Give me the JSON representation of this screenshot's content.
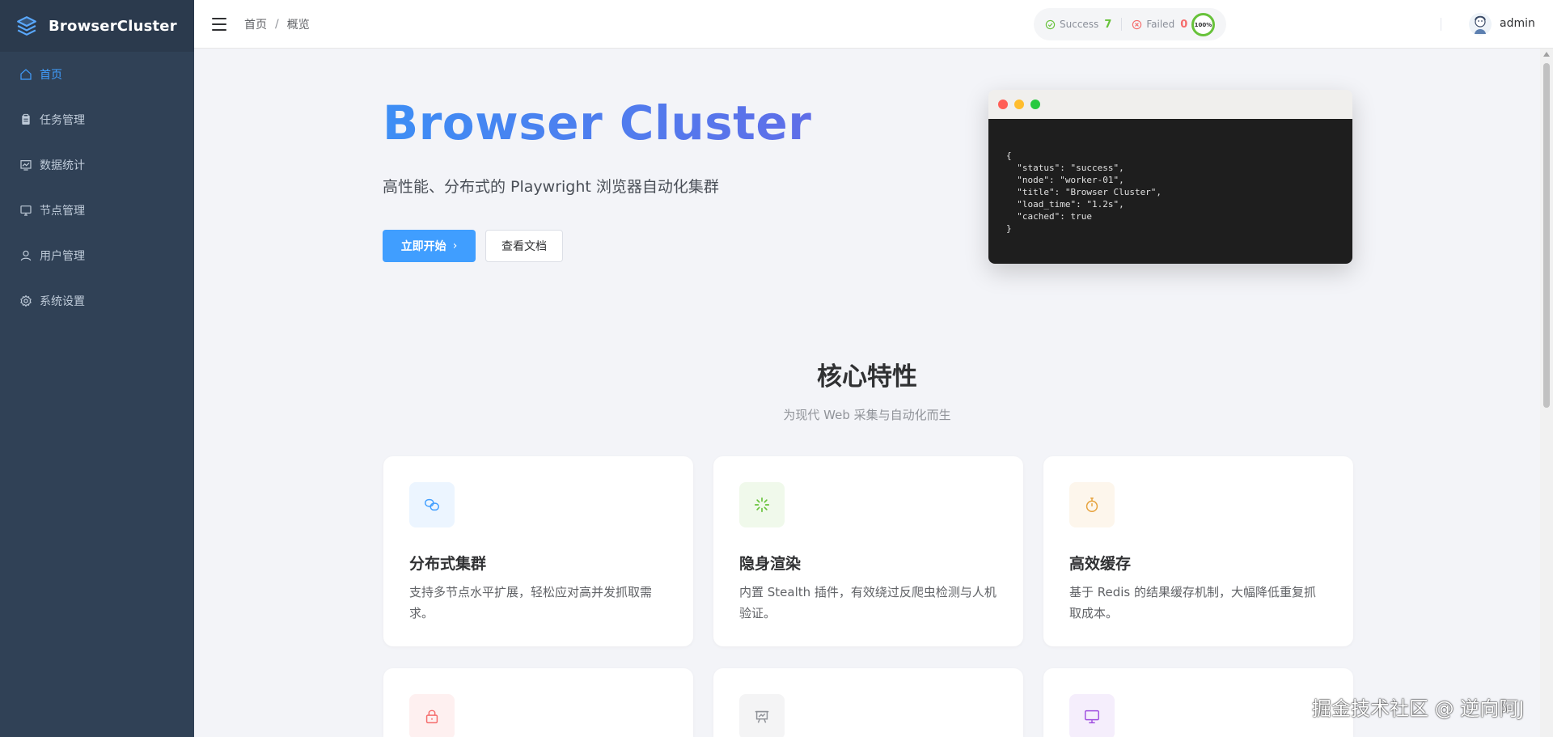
{
  "brand": {
    "name": "BrowserCluster",
    "icon": "layers-icon"
  },
  "sidebar": {
    "items": [
      {
        "label": "首页",
        "icon": "home-icon",
        "active": true
      },
      {
        "label": "任务管理",
        "icon": "clipboard-icon",
        "active": false
      },
      {
        "label": "数据统计",
        "icon": "chart-icon",
        "active": false
      },
      {
        "label": "节点管理",
        "icon": "monitor-icon",
        "active": false
      },
      {
        "label": "用户管理",
        "icon": "user-icon",
        "active": false
      },
      {
        "label": "系统设置",
        "icon": "gear-icon",
        "active": false
      }
    ]
  },
  "header": {
    "breadcrumb": [
      "首页",
      "/",
      "概览"
    ],
    "success_label": "Success",
    "success_count": "7",
    "failed_label": "Failed",
    "failed_count": "0",
    "rate": "100%",
    "username": "admin"
  },
  "hero": {
    "title": "Browser Cluster",
    "subtitle": "高性能、分布式的 Playwright 浏览器自动化集群",
    "primary_label": "立即开始",
    "secondary_label": "查看文档",
    "code": "{\n  \"status\": \"success\",\n  \"node\": \"worker-01\",\n  \"title\": \"Browser Cluster\",\n  \"load_time\": \"1.2s\",\n  \"cached\": true\n}"
  },
  "features": {
    "title": "核心特性",
    "subtitle": "为现代 Web 采集与自动化而生",
    "cards": [
      {
        "title": "分布式集群",
        "desc": "支持多节点水平扩展，轻松应对高并发抓取需求。",
        "icon": "connection-icon",
        "color": "#409eff"
      },
      {
        "title": "隐身渲染",
        "desc": "内置 Stealth 插件，有效绕过反爬虫检测与人机验证。",
        "icon": "loading-sparkle-icon",
        "color": "#67c23a"
      },
      {
        "title": "高效缓存",
        "desc": "基于 Redis 的结果缓存机制，大幅降低重复抓取成本。",
        "icon": "stopwatch-icon",
        "color": "#e6a23c"
      },
      {
        "title": "",
        "desc": "",
        "icon": "lock-icon",
        "color": "#f56c6c"
      },
      {
        "title": "",
        "desc": "",
        "icon": "presentation-icon",
        "color": "#909399"
      },
      {
        "title": "",
        "desc": "",
        "icon": "monitor-icon",
        "color": "#a050e0"
      }
    ]
  },
  "watermark": "掘金技术社区 @ 逆向阿J",
  "colors": {
    "sidebar": "#304156",
    "primary": "#409eff",
    "success": "#67c23a",
    "danger": "#f56c6c"
  }
}
